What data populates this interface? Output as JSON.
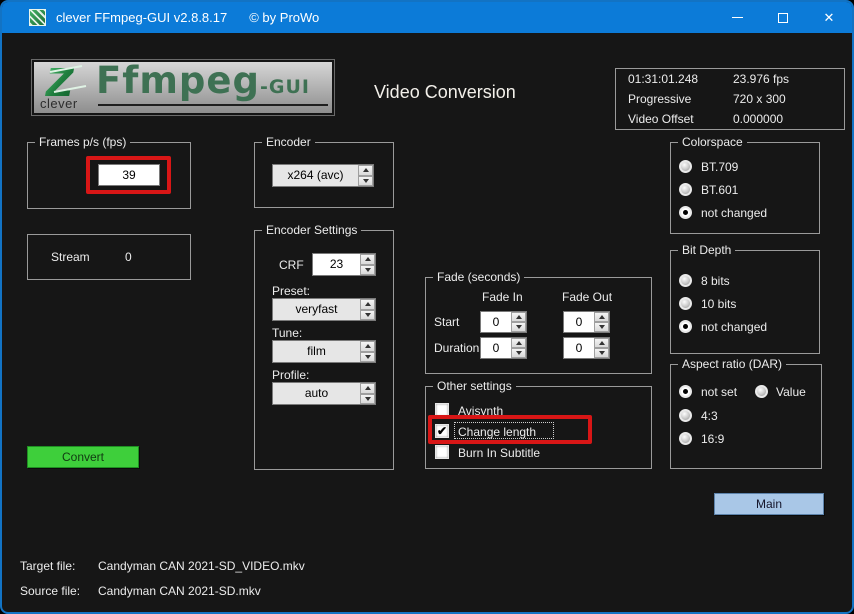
{
  "window": {
    "title": "clever FFmpeg-GUI v2.8.8.17",
    "copyright": "© by ProWo",
    "close_icon": "✕"
  },
  "header": {
    "logo_main": "Ffmpeg",
    "logo_suffix": "-GUI",
    "logo_caption": "clever",
    "page_title": "Video Conversion"
  },
  "media_info": {
    "rows": [
      {
        "label": "01:31:01.248",
        "value": "23.976 fps"
      },
      {
        "label": "Progressive",
        "value": "720 x 300"
      },
      {
        "label": "Video Offset",
        "value": "0.000000"
      }
    ]
  },
  "fps": {
    "group_label": "Frames p/s (fps)",
    "value": "39"
  },
  "stream": {
    "label": "Stream",
    "value": "0"
  },
  "encoder": {
    "group_label": "Encoder",
    "value": "x264 (avc)"
  },
  "encoder_settings": {
    "group_label": "Encoder Settings",
    "crf_label": "CRF",
    "crf_value": "23",
    "preset_label": "Preset:",
    "preset_value": "veryfast",
    "tune_label": "Tune:",
    "tune_value": "film",
    "profile_label": "Profile:",
    "profile_value": "auto"
  },
  "fade": {
    "group_label": "Fade (seconds)",
    "col_in": "Fade In",
    "col_out": "Fade Out",
    "row_start": "Start",
    "row_duration": "Duration",
    "start_in": "0",
    "start_out": "0",
    "duration_in": "0",
    "duration_out": "0"
  },
  "other_settings": {
    "group_label": "Other settings",
    "items": [
      {
        "label": "Avisynth",
        "checked": false
      },
      {
        "label": "Change length",
        "checked": true
      },
      {
        "label": "Burn In Subtitle",
        "checked": false
      }
    ]
  },
  "colorspace": {
    "group_label": "Colorspace",
    "options": [
      {
        "label": "BT.709",
        "selected": false
      },
      {
        "label": "BT.601",
        "selected": false
      },
      {
        "label": "not changed",
        "selected": true
      }
    ]
  },
  "bit_depth": {
    "group_label": "Bit Depth",
    "options": [
      {
        "label": "8 bits",
        "selected": false
      },
      {
        "label": "10 bits",
        "selected": false
      },
      {
        "label": "not changed",
        "selected": true
      }
    ]
  },
  "aspect_ratio": {
    "group_label": "Aspect ratio (DAR)",
    "options": [
      {
        "label": "not set",
        "selected": true
      },
      {
        "label": "Value",
        "selected": false
      },
      {
        "label": "4:3",
        "selected": false
      },
      {
        "label": "16:9",
        "selected": false
      }
    ]
  },
  "buttons": {
    "convert": "Convert",
    "main": "Main"
  },
  "files": {
    "target_label": "Target file:",
    "target_value": "Candyman CAN 2021-SD_VIDEO.mkv",
    "source_label": "Source file:",
    "source_value": "Candyman CAN 2021-SD.mkv"
  },
  "colors": {
    "titlebar": "#0c7bd8",
    "background": "#161616",
    "convert_green": "#3ecf3b",
    "main_blue": "#a9c7e7",
    "annotation_red": "#d81616",
    "logo_green": "#3e7153"
  }
}
